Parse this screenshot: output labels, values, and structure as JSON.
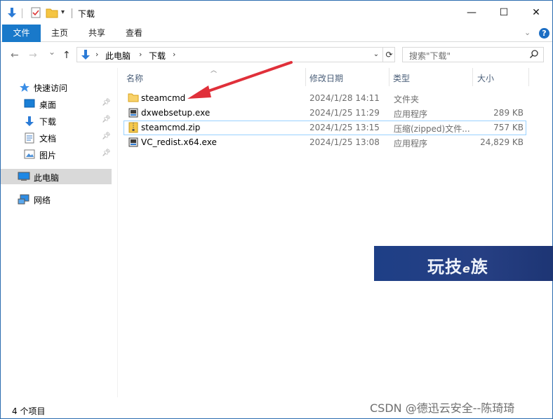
{
  "window": {
    "title": "下载",
    "controls": {
      "minimize": "—",
      "maximize": "☐",
      "close": "✕"
    }
  },
  "quick_access_toolbar": [
    "down-arrow-icon",
    "properties-icon",
    "new-folder-icon",
    "customize-dropdown-icon"
  ],
  "ribbon": {
    "tabs": [
      {
        "label": "文件",
        "active": true
      },
      {
        "label": "主页"
      },
      {
        "label": "共享"
      },
      {
        "label": "查看"
      }
    ],
    "expand_icon": "chevron-down-icon",
    "help_label": "?"
  },
  "address": {
    "back": "←",
    "forward": "→",
    "recent": "⌄",
    "up": "↑",
    "parts": [
      "此电脑",
      "下载"
    ],
    "separator": "›",
    "refresh": "⟳"
  },
  "search": {
    "placeholder": "搜索\"下载\""
  },
  "navpane": {
    "items": [
      {
        "label": "快速访问",
        "icon": "star-icon"
      },
      {
        "label": "桌面",
        "icon": "desktop-icon",
        "pinned": true
      },
      {
        "label": "下载",
        "icon": "download-icon",
        "pinned": true
      },
      {
        "label": "文档",
        "icon": "document-icon",
        "pinned": true
      },
      {
        "label": "图片",
        "icon": "picture-icon",
        "pinned": true
      },
      {
        "label": "此电脑",
        "icon": "computer-icon",
        "selected": true
      },
      {
        "label": "网络",
        "icon": "network-icon"
      }
    ]
  },
  "columns": [
    "名称",
    "修改日期",
    "类型",
    "大小"
  ],
  "files": [
    {
      "name": "steamcmd",
      "date": "2024/1/28 14:11",
      "type": "文件夹",
      "size": "",
      "icon": "folder-icon"
    },
    {
      "name": "dxwebsetup.exe",
      "date": "2024/1/25 11:29",
      "type": "应用程序",
      "size": "289 KB",
      "icon": "installer-icon"
    },
    {
      "name": "steamcmd.zip",
      "date": "2024/1/25 13:15",
      "type": "压缩(zipped)文件...",
      "size": "757 KB",
      "icon": "zip-icon",
      "selected": true
    },
    {
      "name": "VC_redist.x64.exe",
      "date": "2024/1/25 13:08",
      "type": "应用程序",
      "size": "24,829 KB",
      "icon": "installer-icon"
    }
  ],
  "status": {
    "item_count": "4 个项目"
  },
  "banner": {
    "text_1": "玩技",
    "text_e": "e",
    "text_2": "族"
  },
  "watermark": "CSDN @德迅云安全--陈琦琦",
  "colors": {
    "accent": "#1979ca",
    "selection_border": "#99d1ff",
    "arrow": "#e0303a",
    "banner": "#1e3f86"
  }
}
